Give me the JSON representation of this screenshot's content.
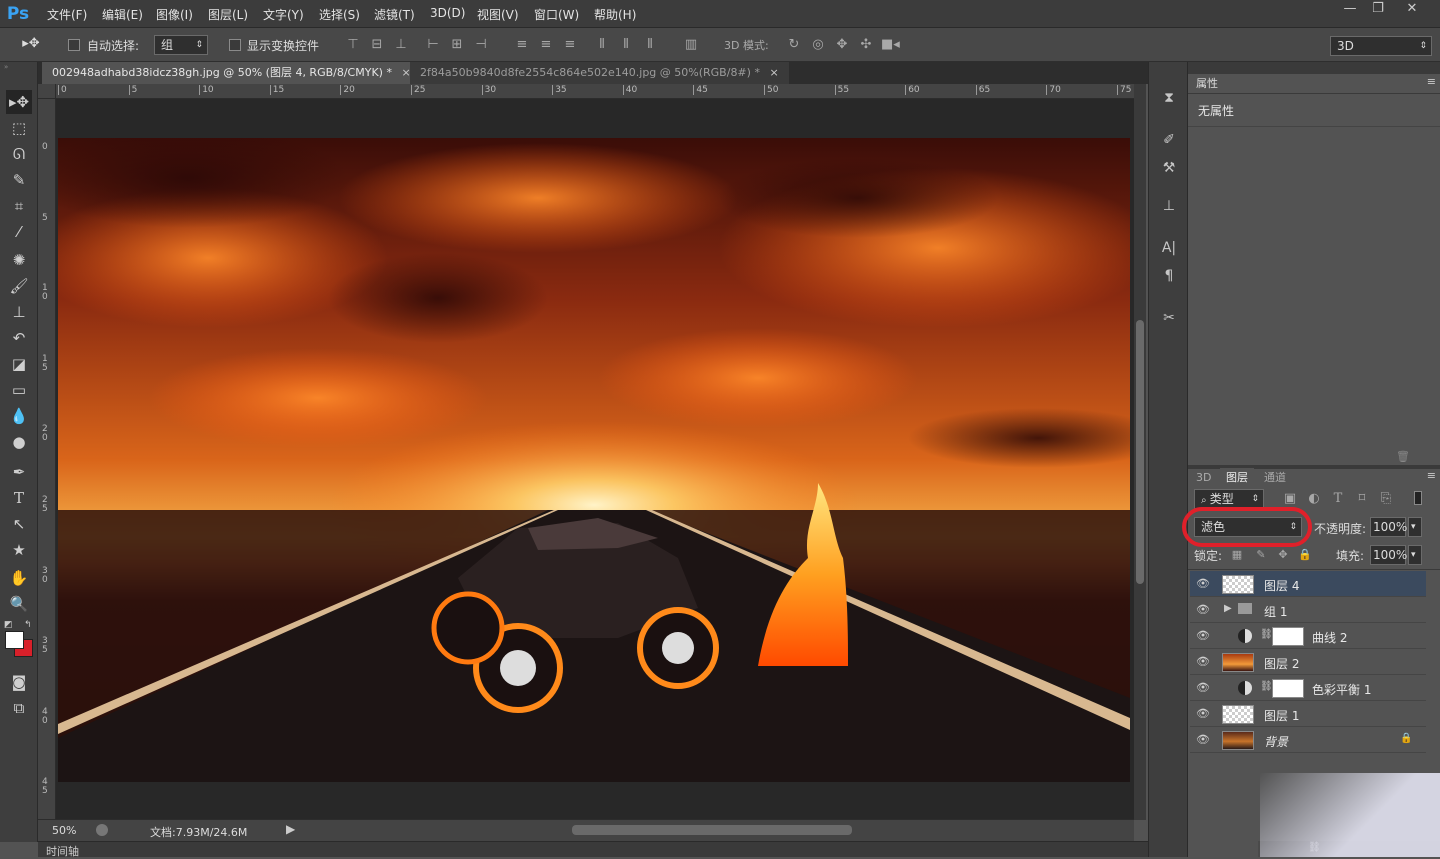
{
  "app": {
    "logo": "Ps"
  },
  "menu": [
    "文件(F)",
    "编辑(E)",
    "图像(I)",
    "图层(L)",
    "文字(Y)",
    "选择(S)",
    "滤镜(T)",
    "3D(D)",
    "视图(V)",
    "窗口(W)",
    "帮助(H)"
  ],
  "window_controls": {
    "minimize": "—",
    "restore": "❐",
    "close": "✕"
  },
  "options": {
    "auto_select_label": "自动选择:",
    "auto_select_value": "组",
    "show_transform_label": "显示变换控件",
    "mode_3d_label": "3D 模式:",
    "workspace_value": "3D"
  },
  "tabs": [
    {
      "label": "002948adhabd38idcz38gh.jpg @ 50% (图层 4, RGB/8/CMYK) *",
      "active": true
    },
    {
      "label": "2f84a50b9840d8fe2554c864e502e140.jpg @ 50%(RGB/8#) *",
      "active": false
    }
  ],
  "ruler_top": [
    "0",
    "5",
    "10",
    "15",
    "20",
    "25",
    "30",
    "35",
    "40",
    "45",
    "50",
    "55",
    "60",
    "65",
    "70",
    "75"
  ],
  "ruler_left": [
    "0",
    "5",
    "10",
    "15",
    "20",
    "25",
    "30",
    "35",
    "40",
    "45"
  ],
  "status": {
    "zoom": "50%",
    "doc": "文档:7.93M/24.6M"
  },
  "timeline_label": "时间轴",
  "properties": {
    "tab": "属性",
    "content": "无属性"
  },
  "layers_panel": {
    "tabs": [
      "3D",
      "图层",
      "通道"
    ],
    "filter_label": "类型",
    "blend_mode": "滤色",
    "opacity_label": "不透明度:",
    "opacity_value": "100%",
    "lock_label": "锁定:",
    "fill_label": "填充:",
    "fill_value": "100%",
    "layers": [
      {
        "name": "图层 4",
        "active": true
      },
      {
        "name": "组 1",
        "group": true
      },
      {
        "name": "曲线 2",
        "adjustment": true
      },
      {
        "name": "图层 2"
      },
      {
        "name": "色彩平衡 1",
        "adjustment": true
      },
      {
        "name": "图层 1"
      },
      {
        "name": "背景",
        "locked": true
      }
    ]
  },
  "colors": {
    "accent_annotation": "#e0202a",
    "active_layer": "#3b4a5e"
  }
}
